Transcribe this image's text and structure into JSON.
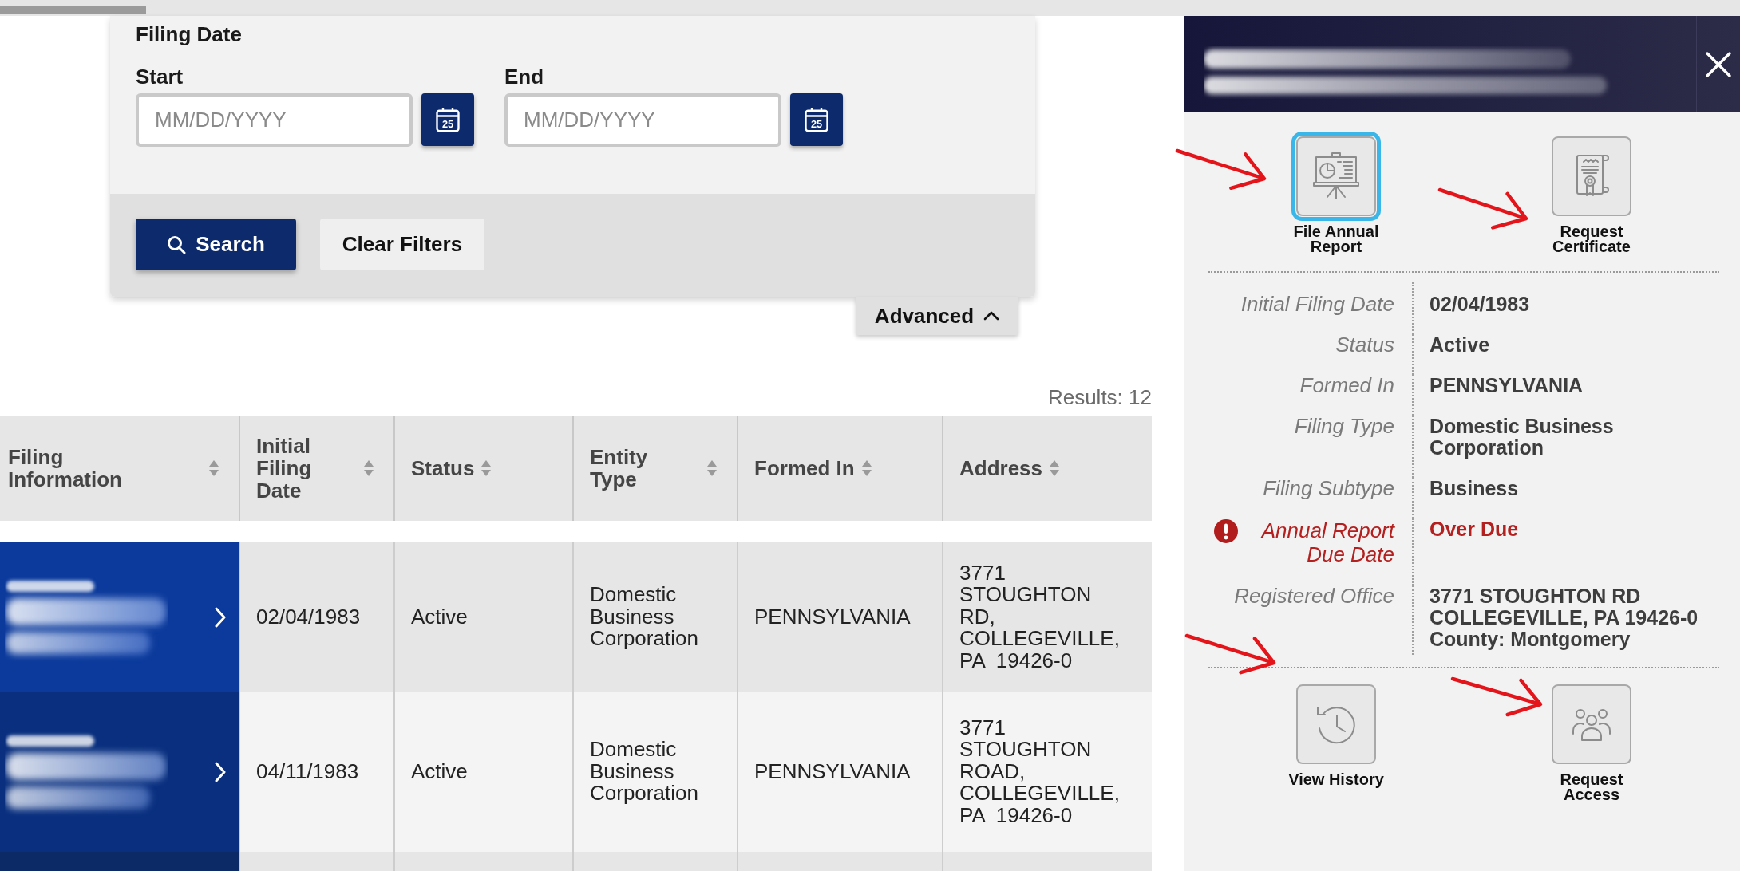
{
  "filters": {
    "section_title": "Filing Date",
    "date_fields": [
      {
        "label": "Start",
        "placeholder": "MM/DD/YYYY",
        "calendar_icon_text": "25"
      },
      {
        "label": "End",
        "placeholder": "MM/DD/YYYY",
        "calendar_icon_text": "25"
      }
    ],
    "buttons": [
      {
        "label": "Search",
        "kind": "primary"
      },
      {
        "label": "Clear Filters",
        "kind": "secondary"
      }
    ],
    "advanced_toggle": {
      "label": "Advanced",
      "expanded": true
    }
  },
  "results_count": "Results: 12",
  "table": {
    "columns": [
      "Filing Information",
      "Initial Filing Date",
      "Status",
      "Entity Type",
      "Formed In",
      "Address"
    ],
    "rows": [
      {
        "selected": true,
        "cells": [
          "",
          "02/04/1983",
          "Active",
          "Domestic Business Corporation",
          "PENNSYLVANIA",
          "3771 STOUGHTON RD, COLLEGEVILLE, PA  19426-0"
        ]
      },
      {
        "selected": false,
        "cells": [
          "",
          "04/11/1983",
          "Active",
          "Domestic Business Corporation",
          "PENNSYLVANIA",
          "3771 STOUGHTON ROAD, COLLEGEVILLE, PA  19426-0"
        ]
      }
    ]
  },
  "detail_panel": {
    "actions": [
      {
        "label": "File Annual Report",
        "focused": true,
        "annotated": true
      },
      {
        "label": "Request Certificate",
        "focused": false,
        "annotated": true
      }
    ],
    "fields": [
      {
        "label": "Initial Filing Date",
        "value": "02/04/1983",
        "alert": false
      },
      {
        "label": "Status",
        "value": "Active",
        "alert": false
      },
      {
        "label": "Formed In",
        "value": "PENNSYLVANIA",
        "alert": false
      },
      {
        "label": "Filing Type",
        "value": "Domestic Business Corporation",
        "alert": false
      },
      {
        "label": "Filing Subtype",
        "value": "Business",
        "alert": false
      },
      {
        "label": "Annual Report Due Date",
        "value": "Over Due",
        "alert": true
      },
      {
        "label": "Registered Office",
        "value_lines": [
          "3771 STOUGHTON RD",
          "COLLEGEVILLE, PA 19426-0",
          "County: Montgomery"
        ],
        "alert": false
      }
    ],
    "more_actions": [
      {
        "label": "View History",
        "annotated": true
      },
      {
        "label": "Request Access",
        "annotated": true
      }
    ]
  }
}
